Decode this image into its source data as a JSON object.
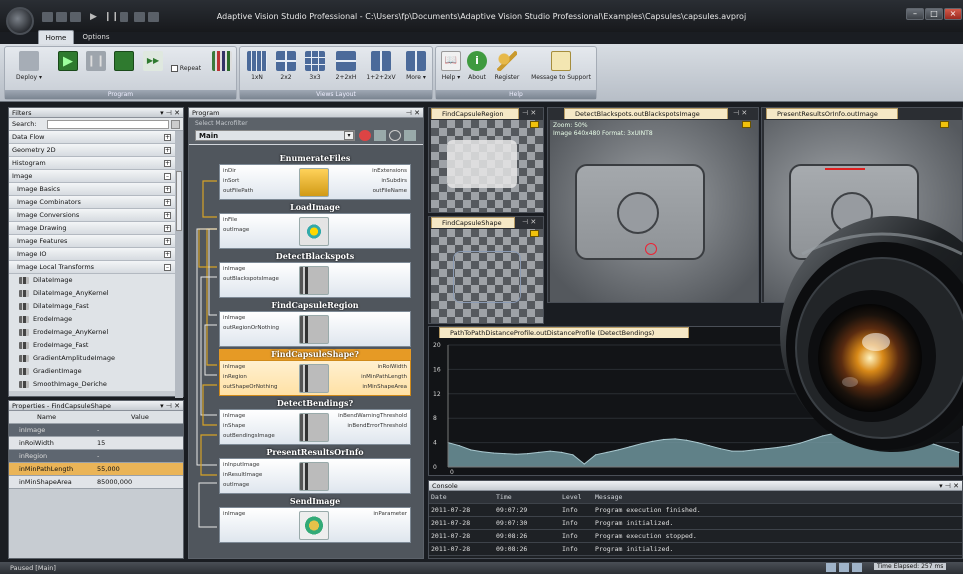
{
  "window": {
    "title": "Adaptive Vision Studio Professional - C:\\Users\\fp\\Documents\\Adaptive Vision Studio Professional\\Examples\\Capsules\\capsules.avproj"
  },
  "tabs": [
    "Home",
    "Options"
  ],
  "ribbon": {
    "program": {
      "deploy": "Deploy ▾",
      "step": "Step",
      "repeat": "Repeat",
      "group": "Program"
    },
    "views": {
      "items": [
        "1xN",
        "2x2",
        "3x3",
        "2+2xH",
        "1+2+2xV",
        "More ▾"
      ],
      "group": "Views Layout"
    },
    "help": {
      "items": [
        "Help ▾",
        "About",
        "Register",
        "Message to Support"
      ],
      "group": "Help"
    }
  },
  "filters": {
    "header": "Filters",
    "search_label": "Search:",
    "categories": [
      "Data Flow",
      "Geometry 2D",
      "Histogram",
      "Image"
    ],
    "subcategories": [
      "Image Basics",
      "Image Combinators",
      "Image Conversions",
      "Image Drawing",
      "Image Features",
      "Image IO",
      "Image Local Transforms"
    ],
    "items": [
      "DilateImage",
      "DilateImage_AnyKernel",
      "DilateImage_Fast",
      "ErodeImage",
      "ErodeImage_AnyKernel",
      "ErodeImage_Fast",
      "GradientAmplitudeImage",
      "GradientImage",
      "SmoothImage_Deriche"
    ]
  },
  "properties": {
    "header": "Properties - FindCapsuleShape",
    "col_name": "Name",
    "col_value": "Value",
    "rows": [
      {
        "name": "inImage",
        "value": "-"
      },
      {
        "name": "inRoiWidth",
        "value": "15"
      },
      {
        "name": "inRegion",
        "value": "-"
      },
      {
        "name": "inMinPathLength",
        "value": "55,000"
      },
      {
        "name": "inMinShapeArea",
        "value": "85000,000"
      }
    ]
  },
  "program": {
    "header": "Program",
    "select_label": "Select Macrofilter",
    "macrofilter": "Main",
    "nodes": [
      {
        "title": "EnumerateFiles",
        "inputs": [
          "inDir",
          "inSort",
          "outFilePath"
        ],
        "outputs": [
          "inExtensions",
          "inSubdirs",
          "outFileName"
        ]
      },
      {
        "title": "LoadImage",
        "inputs": [
          "inFile",
          "outImage"
        ],
        "outputs": []
      },
      {
        "title": "DetectBlackspots",
        "inputs": [
          "inImage",
          "outBlackspotsImage"
        ],
        "outputs": []
      },
      {
        "title": "FindCapsuleRegion",
        "inputs": [
          "inImage",
          "outRegionOrNothing"
        ],
        "outputs": []
      },
      {
        "title": "FindCapsuleShape?",
        "inputs": [
          "inImage",
          "inRegion",
          "outShapeOrNothing"
        ],
        "outputs": [
          "inRoiWidth",
          "inMinPathLength",
          "inMinShapeArea"
        ]
      },
      {
        "title": "DetectBendings?",
        "inputs": [
          "inImage",
          "inShape",
          "outBendingsImage"
        ],
        "outputs": [
          "inBendWarningThreshold",
          "inBendErrorThreshold"
        ]
      },
      {
        "title": "PresentResultsOrInfo",
        "inputs": [
          "inInputImage",
          "inResultImage",
          "outImage"
        ],
        "outputs": []
      },
      {
        "title": "SendImage",
        "inputs": [
          "inImage"
        ],
        "outputs": [
          "inParameter"
        ]
      }
    ]
  },
  "views": {
    "region": "FindCapsuleRegion",
    "shape": "FindCapsuleShape",
    "blackspots": "DetectBlackspots.outBlackspotsImage",
    "zoom": "Zoom: 50%",
    "imginfo": "Image 640x480 Format: 3xUINT8",
    "present": "PresentResultsOrInfo.outImage",
    "profile": "PathToPathDistanceProfile.outDistanceProfile (DetectBendings)"
  },
  "chart_data": {
    "type": "area",
    "title": "",
    "xlabel": "",
    "ylabel": "",
    "ylim": [
      0,
      20
    ],
    "yticks": [
      0,
      4,
      8,
      12,
      16,
      20
    ],
    "x_first_tick": "0",
    "values": [
      4.0,
      3.5,
      2.8,
      2.5,
      2.3,
      2.2,
      2.1,
      2.2,
      2.4,
      2.6,
      2.4,
      2.0,
      0.5,
      2.0,
      2.4,
      2.8,
      3.3,
      3.8,
      4.2,
      4.5,
      4.6,
      4.4,
      4.0,
      3.5,
      3.0,
      2.6,
      2.6,
      2.8,
      3.0,
      3.2,
      3.5,
      3.9,
      4.5,
      5.1,
      5.5,
      5.7,
      5.8,
      5.8,
      5.7,
      5.5,
      5.2,
      4.8,
      4.2,
      3.6,
      3.0,
      2.4
    ],
    "fill_color": "#6f949c",
    "line_color": "#a9c8cf"
  },
  "console": {
    "header": "Console",
    "columns": [
      "Date",
      "Time",
      "Level",
      "Message"
    ],
    "rows": [
      [
        "2011-07-28",
        "09:07:29",
        "Info",
        "Program execution finished."
      ],
      [
        "2011-07-28",
        "09:07:30",
        "Info",
        "Program initialized."
      ],
      [
        "2011-07-28",
        "09:08:26",
        "Info",
        "Program execution stopped."
      ],
      [
        "2011-07-28",
        "09:08:26",
        "Info",
        "Program initialized."
      ]
    ]
  },
  "status": {
    "left": "Paused [Main]",
    "right": "Time Elapsed: 257 ms"
  }
}
